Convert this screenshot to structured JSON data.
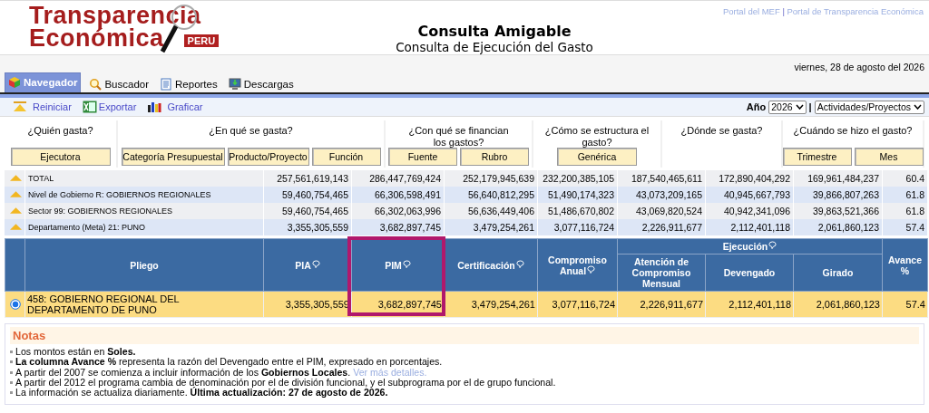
{
  "logo": {
    "line1": "Transparencia",
    "line2": "Económica",
    "badge": "PERU"
  },
  "top_links": {
    "items": [
      "Portal del MEF",
      "Portal de Transparencia Económica"
    ],
    "separator": "|"
  },
  "title": "Consulta Amigable",
  "subtitle": "Consulta de Ejecución del Gasto",
  "date": "viernes, 28 de agosto del 2026",
  "tabs": [
    {
      "label": "Navegador",
      "kind": "cube",
      "selected": true
    },
    {
      "label": "Buscador",
      "kind": "search",
      "selected": false
    },
    {
      "label": "Reportes",
      "kind": "document",
      "selected": false
    },
    {
      "label": "Descargas",
      "kind": "monitor",
      "selected": false
    }
  ],
  "toolbar": {
    "actions": [
      {
        "label": "Reiniciar",
        "kind": "reset"
      },
      {
        "label": "Exportar",
        "kind": "spreadsheet"
      },
      {
        "label": "Graficar",
        "kind": "chart"
      }
    ],
    "year_label": "Año",
    "year": "2026",
    "separator": "|",
    "view": "Actividades/Proyectos"
  },
  "filter_groups": [
    {
      "question": "¿Quién gasta?",
      "buttons": [
        "Ejecutora"
      ]
    },
    {
      "question": "¿En qué se gasta?",
      "buttons": [
        "Categoría Presupuestal",
        "Producto/Proyecto",
        "Función"
      ]
    },
    {
      "question": "¿Con qué se financian los gastos?",
      "buttons": [
        "Fuente",
        "Rubro"
      ]
    },
    {
      "question": "¿Cómo se estructura el gasto?",
      "buttons": [
        "Genérica"
      ]
    },
    {
      "question": "¿Dónde se gasta?"
    },
    {
      "question": "¿Cuándo se hizo el gasto?",
      "buttons": [
        "Trimestre",
        "Mes"
      ]
    }
  ],
  "summary_rows": [
    {
      "label": "TOTAL",
      "values": [
        "257,561,619,143",
        "286,447,769,424",
        "252,179,945,639",
        "232,200,385,105",
        "187,540,465,611",
        "172,890,404,292",
        "169,961,484,237",
        "60.4"
      ]
    },
    {
      "label": "Nivel de Gobierno R: GOBIERNOS REGIONALES",
      "values": [
        "59,460,754,465",
        "66,306,598,491",
        "56,640,812,295",
        "51,490,174,323",
        "43,073,209,165",
        "40,945,667,793",
        "39,866,807,263",
        "61.8"
      ]
    },
    {
      "label": "Sector 99: GOBIERNOS REGIONALES",
      "values": [
        "59,460,754,465",
        "66,302,063,996",
        "56,636,449,406",
        "51,486,670,802",
        "43,069,820,524",
        "40,942,341,096",
        "39,863,521,366",
        "61.8"
      ]
    },
    {
      "label": "Departamento (Meta) 21: PUNO",
      "values": [
        "3,355,305,559",
        "3,682,897,745",
        "3,479,254,261",
        "3,077,116,724",
        "2,226,911,677",
        "2,112,401,118",
        "2,061,860,123",
        "57.4"
      ]
    }
  ],
  "table": {
    "columns": [
      {
        "label": "Pliego",
        "info": false,
        "highlighted": false
      },
      {
        "label": "PIA",
        "info": true,
        "highlighted": false
      },
      {
        "label": "PIM",
        "info": true,
        "highlighted": true
      },
      {
        "label": "Certificación",
        "info": true,
        "highlighted": false
      },
      {
        "label": "Compromiso Anual",
        "info": true,
        "highlighted": false
      },
      {
        "label": "Ejecución",
        "info": true,
        "highlighted": false,
        "children": [
          "Atención de Compromiso Mensual",
          "Devengado",
          "Girado"
        ]
      },
      {
        "label": "Avance %",
        "info": false,
        "highlighted": false
      }
    ],
    "rows": [
      {
        "selected": true,
        "pliego": "458: GOBIERNO REGIONAL DEL DEPARTAMENTO DE PUNO",
        "values": [
          "3,355,305,559",
          "3,682,897,745",
          "3,479,254,261",
          "3,077,116,724",
          "2,226,911,677",
          "2,112,401,118",
          "2,061,860,123",
          "57.4"
        ]
      }
    ]
  },
  "notes": {
    "title": "Notas",
    "items": [
      {
        "text": "Los montos están en **Soles.**"
      },
      {
        "text": "**La columna Avance %** representa la razón del Devengado entre el PIM, expresado en porcentajes."
      },
      {
        "text": "A partir del 2007 se comienza a incluir información de los **Gobiernos Locales**.",
        "link": "Ver más detalles."
      },
      {
        "text": "A partir del 2012 el programa cambia de denominación por el de división funcional, y el subprograma por el de grupo funcional."
      },
      {
        "text": "La información se actualiza diariamente. **Última actualización: 27 de agosto de 2026.**"
      }
    ]
  }
}
